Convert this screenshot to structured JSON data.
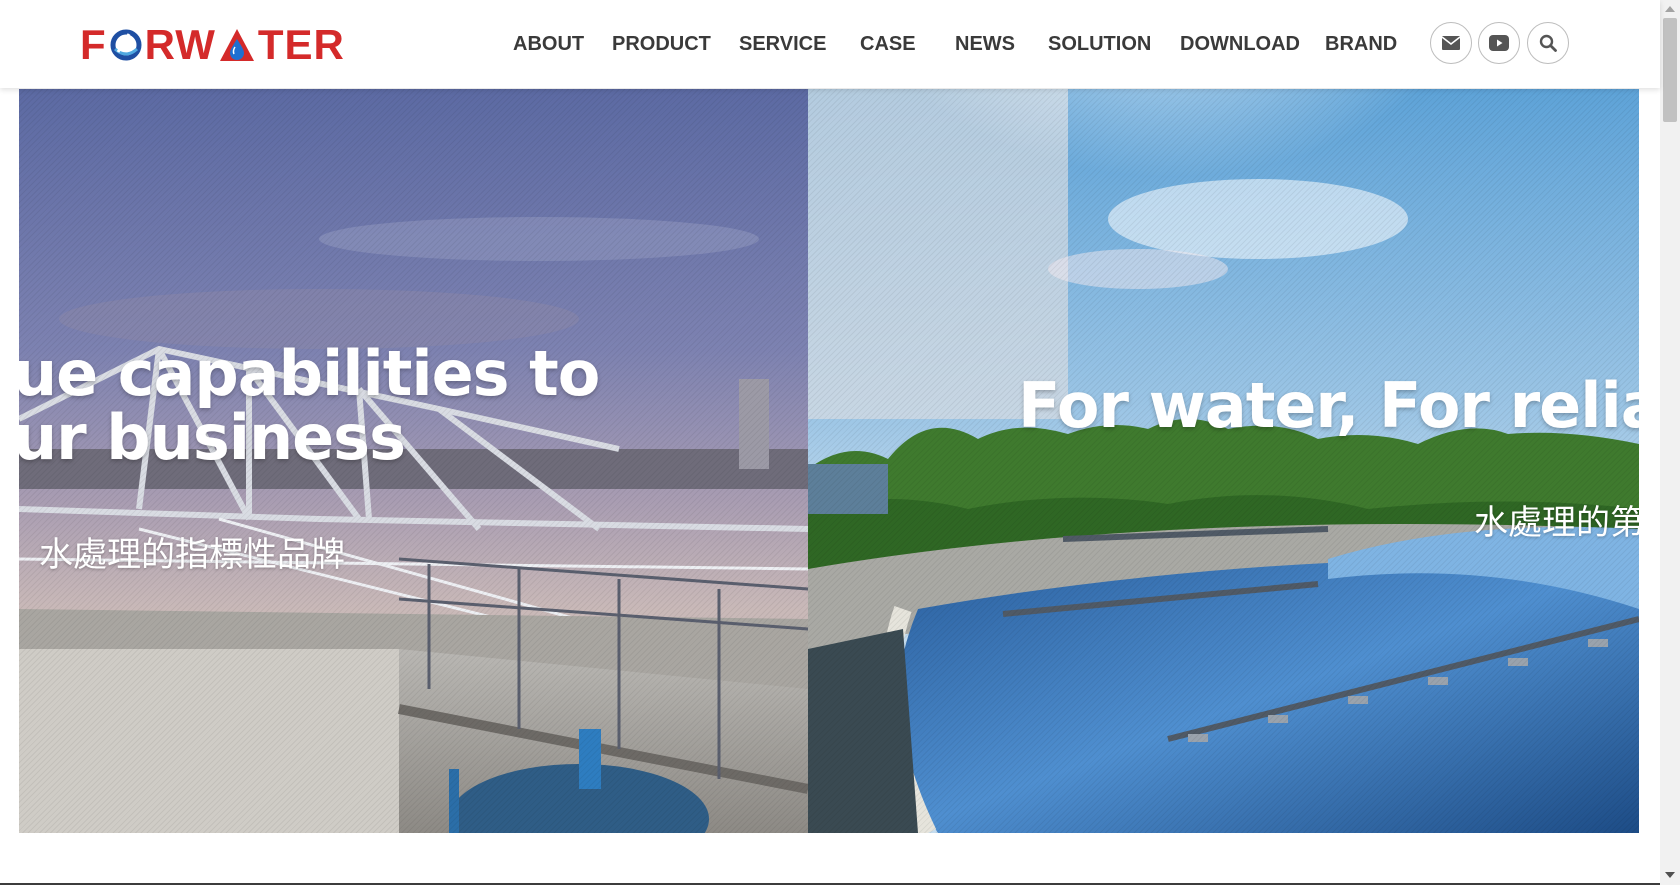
{
  "brand": {
    "name": "FORWATER",
    "primary_color": "#d42a2a",
    "secondary_color": "#1f4fa3"
  },
  "nav": {
    "items": [
      {
        "label": "ABOUT"
      },
      {
        "label": "PRODUCT"
      },
      {
        "label": "SERVICE"
      },
      {
        "label": "CASE"
      },
      {
        "label": "NEWS"
      },
      {
        "label": "SOLUTION"
      },
      {
        "label": "DOWNLOAD"
      },
      {
        "label": "BRAND"
      }
    ],
    "icons": [
      "envelope-icon",
      "youtube-icon",
      "search-icon"
    ]
  },
  "hero": {
    "left_slide": {
      "headline_line1": "ue capabilities to",
      "headline_line2": "ur business",
      "subline": "，水處理的指標性品牌"
    },
    "right_slide": {
      "headline": "For water, For reliab",
      "subline": "水處理的第"
    }
  }
}
